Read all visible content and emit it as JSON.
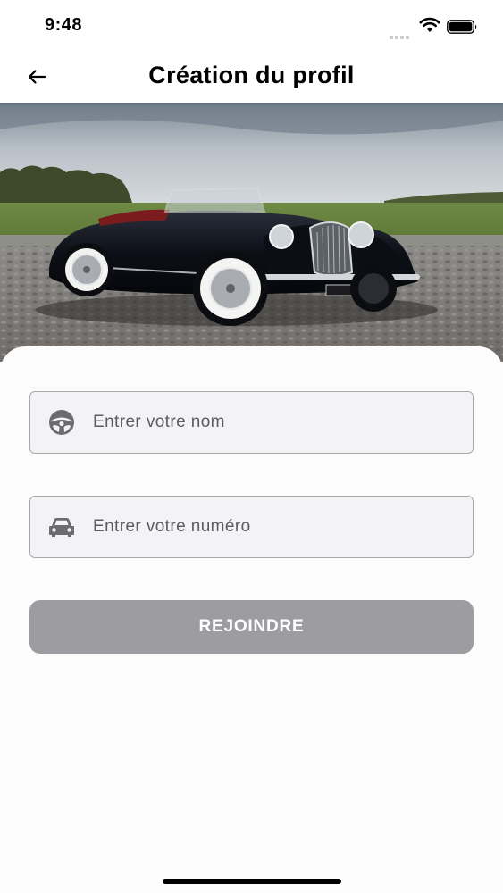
{
  "status_bar": {
    "time": "9:48",
    "icons": [
      "signal-icon",
      "wifi-icon",
      "battery-icon"
    ]
  },
  "header": {
    "back_icon": "arrow-left-icon",
    "title": "Création du profil"
  },
  "form": {
    "name_field": {
      "icon": "steering-wheel-icon",
      "placeholder": "Entrer votre nom"
    },
    "phone_field": {
      "icon": "car-icon",
      "placeholder": "Entrer votre numéro"
    },
    "submit_label": "REJOINDRE"
  },
  "colors": {
    "button_bg": "#9d9ca1",
    "field_bg": "#f3f2f5",
    "field_border": "#a9a9ad",
    "placeholder_text": "#5b5b60"
  }
}
